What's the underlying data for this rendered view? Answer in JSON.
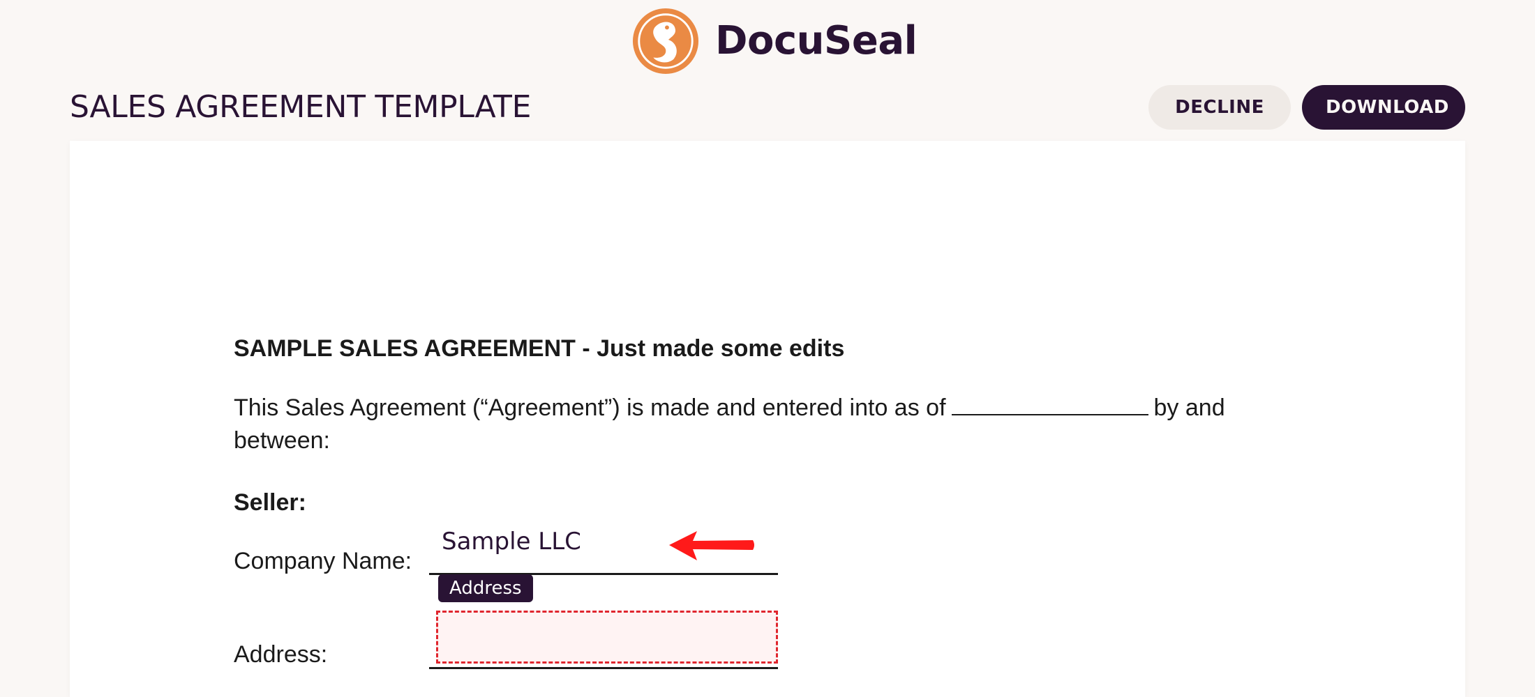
{
  "header": {
    "brand_name": "DocuSeal",
    "brand_color": "#ea8a44",
    "logo_icon": "docuseal-logo-icon"
  },
  "toolbar": {
    "title": "SALES AGREEMENT TEMPLATE",
    "decline_label": "DECLINE",
    "download_label": "DOWNLOAD"
  },
  "document": {
    "heading": "SAMPLE SALES AGREEMENT - Just made some edits",
    "intro_part1": "This Sales Agreement (“Agreement”) is made and entered into as of",
    "intro_part2": "by and",
    "intro_line2": "between:",
    "seller_label": "Seller:",
    "company_label": "Company Name:",
    "company_value": "Sample LLC",
    "address_label": "Address:",
    "address_field_tag": "Address",
    "address_field_value": ""
  },
  "colors": {
    "primary": "#291334",
    "background": "#faf7f5",
    "required_field_border": "#e0262e",
    "arrow": "#ff1a1a"
  }
}
